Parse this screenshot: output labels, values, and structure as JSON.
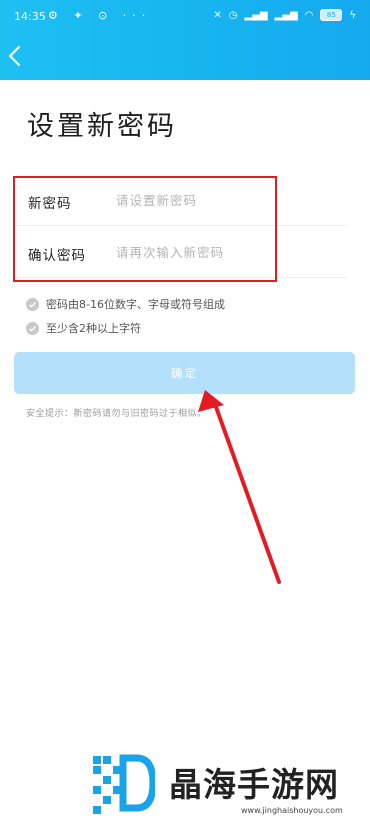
{
  "status_bar": {
    "time": "14:35",
    "battery": "85"
  },
  "page": {
    "title": "设置新密码"
  },
  "form": {
    "new_password": {
      "label": "新密码",
      "placeholder": "请设置新密码",
      "value": ""
    },
    "confirm_password": {
      "label": "确认密码",
      "placeholder": "请再次输入新密码",
      "value": ""
    }
  },
  "rules": [
    "密码由8-16位数字、字母或符号组成",
    "至少含2种以上字符"
  ],
  "submit_label": "确定",
  "tip": "安全提示：新密码请勿与旧密码过于相似。",
  "watermark": {
    "text": "晶海手游网",
    "url": "www.jinghaishouyou.com"
  },
  "colors": {
    "header": "#16b3f0",
    "submit_disabled": "#b3e0fb",
    "highlight": "#e21c22"
  }
}
